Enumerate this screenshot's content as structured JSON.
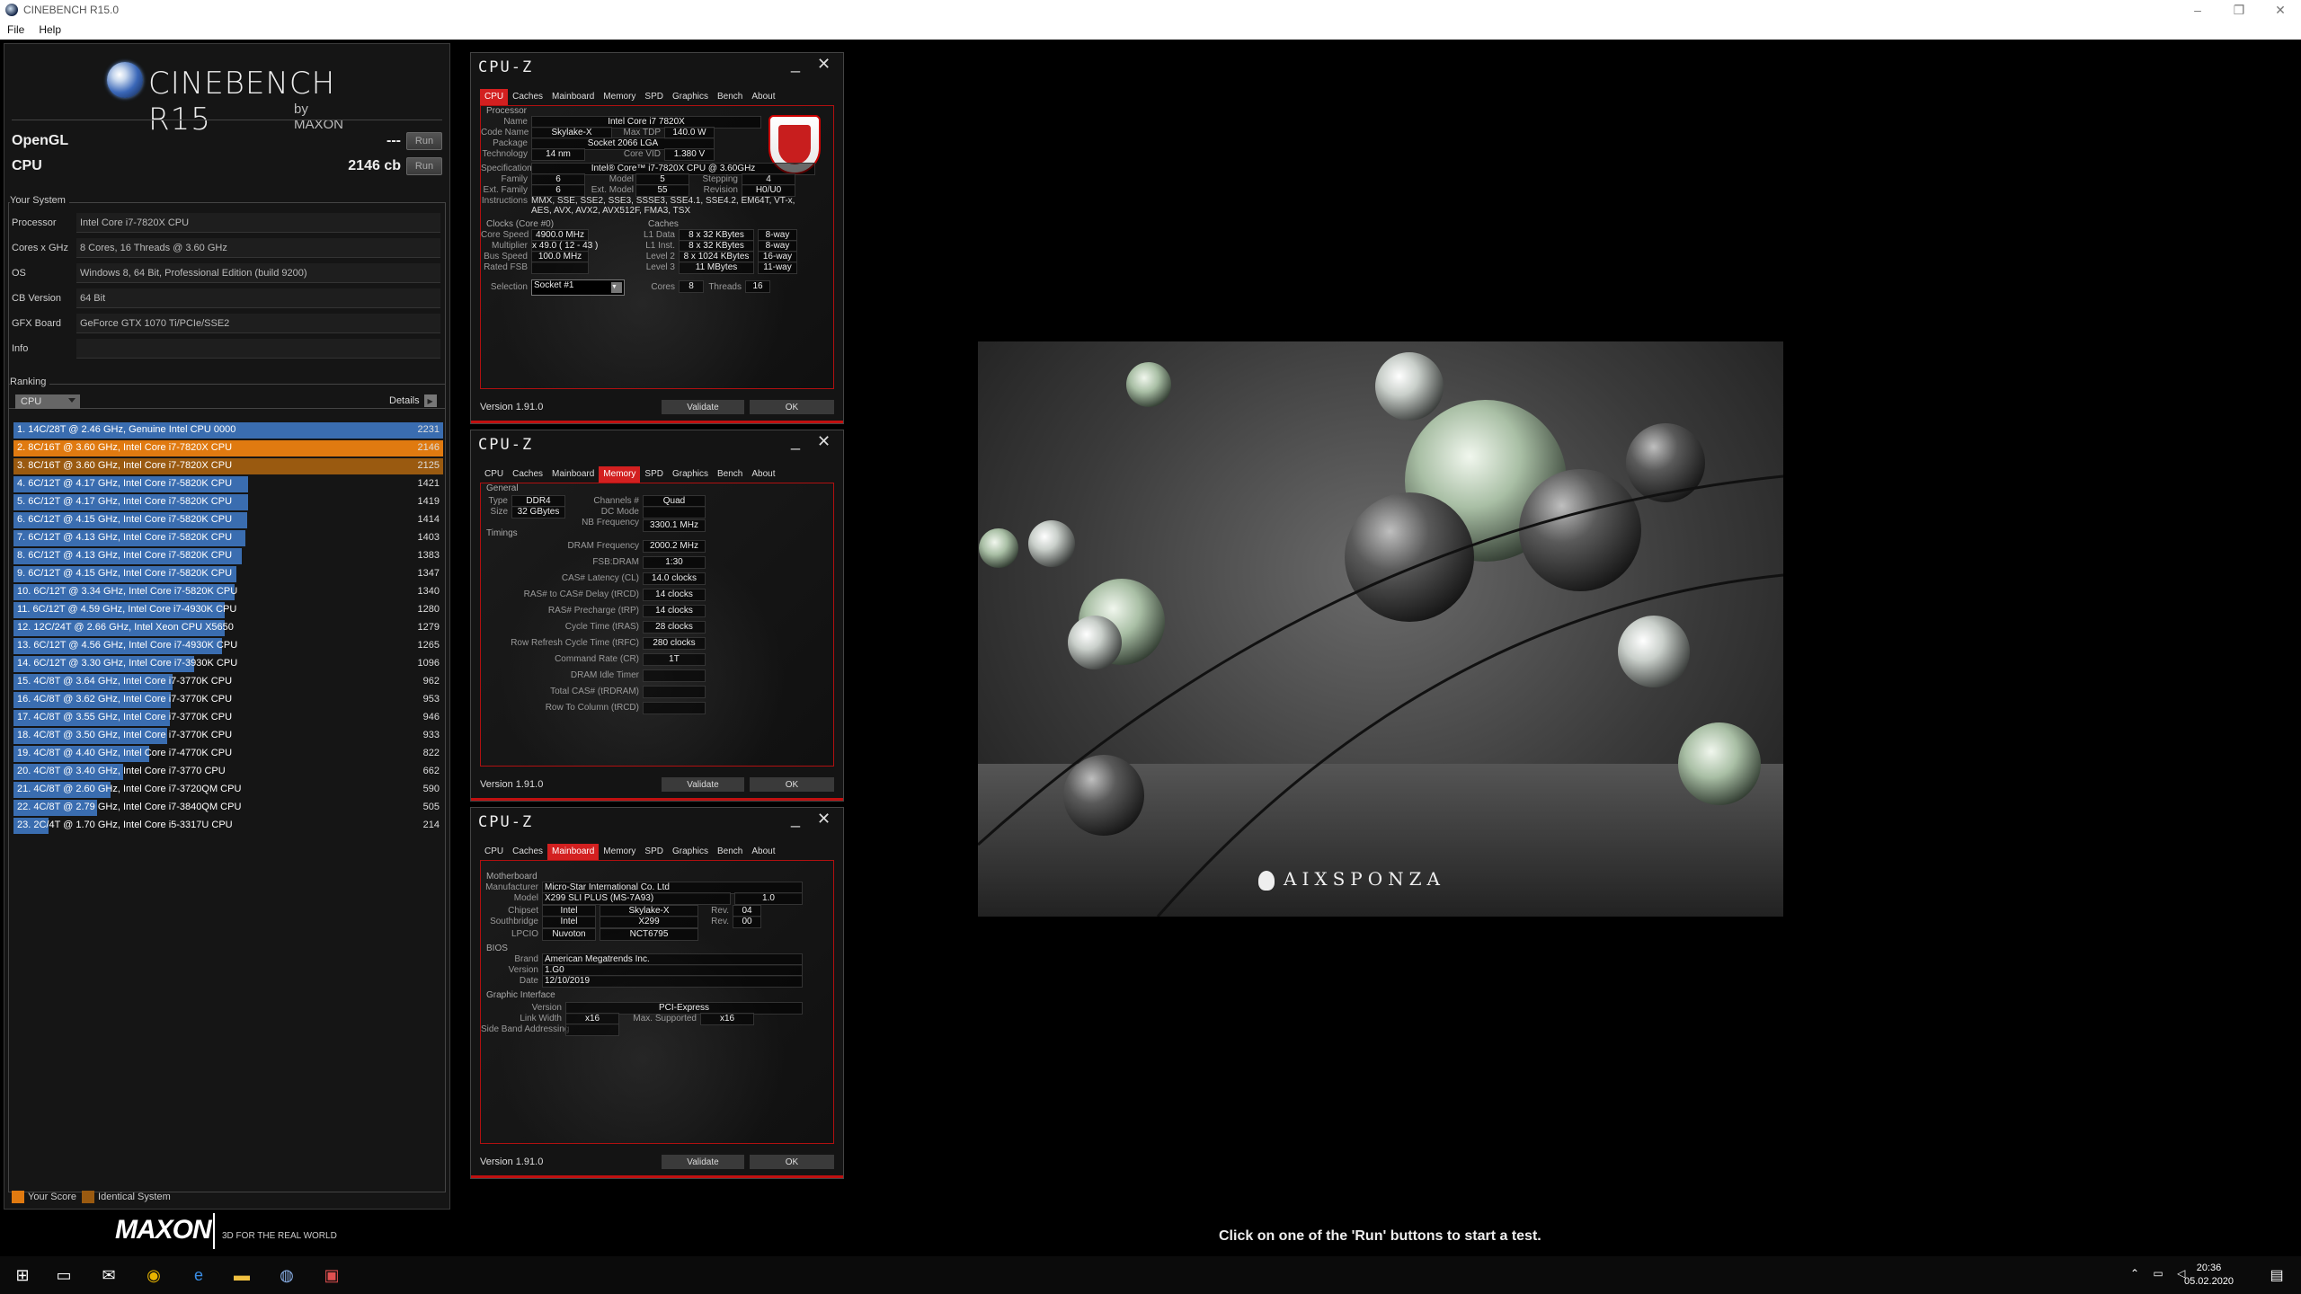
{
  "window": {
    "title": "CINEBENCH R15.0"
  },
  "menu": {
    "file": "File",
    "help": "Help"
  },
  "cinebench": {
    "logo": {
      "name": "CINEBENCH R15",
      "by": "by MAXON"
    },
    "opengl": {
      "label": "OpenGL",
      "value": "---",
      "run": "Run"
    },
    "cpu": {
      "label": "CPU",
      "value": "2146 cb",
      "run": "Run"
    },
    "your_system": {
      "title": "Your System",
      "rows": [
        {
          "k": "Processor",
          "v": "Intel Core i7-7820X CPU"
        },
        {
          "k": "Cores x GHz",
          "v": "8 Cores, 16 Threads @ 3.60 GHz"
        },
        {
          "k": "OS",
          "v": "Windows 8, 64 Bit, Professional Edition (build 9200)"
        },
        {
          "k": "CB Version",
          "v": "64 Bit"
        },
        {
          "k": "GFX Board",
          "v": "GeForce GTX 1070 Ti/PCIe/SSE2"
        },
        {
          "k": "Info",
          "v": ""
        }
      ]
    },
    "ranking": {
      "title": "Ranking",
      "select": "CPU",
      "details": "Details",
      "max": 2231,
      "items": [
        {
          "label": "1. 14C/28T @ 2.46 GHz, Genuine Intel CPU 0000",
          "score": 2231,
          "kind": "other"
        },
        {
          "label": "2. 8C/16T @ 3.60 GHz, Intel Core i7-7820X CPU",
          "score": 2146,
          "kind": "yours"
        },
        {
          "label": "3. 8C/16T @ 3.60 GHz, Intel Core i7-7820X CPU",
          "score": 2125,
          "kind": "identical"
        },
        {
          "label": "4. 6C/12T @ 4.17 GHz, Intel Core i7-5820K CPU",
          "score": 1421,
          "kind": "other"
        },
        {
          "label": "5. 6C/12T @ 4.17 GHz, Intel Core i7-5820K CPU",
          "score": 1419,
          "kind": "other"
        },
        {
          "label": "6. 6C/12T @ 4.15 GHz, Intel Core i7-5820K CPU",
          "score": 1414,
          "kind": "other"
        },
        {
          "label": "7. 6C/12T @ 4.13 GHz, Intel Core i7-5820K CPU",
          "score": 1403,
          "kind": "other"
        },
        {
          "label": "8. 6C/12T @ 4.13 GHz, Intel Core i7-5820K CPU",
          "score": 1383,
          "kind": "other"
        },
        {
          "label": "9. 6C/12T @ 4.15 GHz, Intel Core i7-5820K CPU",
          "score": 1347,
          "kind": "other"
        },
        {
          "label": "10. 6C/12T @ 3.34 GHz, Intel Core i7-5820K CPU",
          "score": 1340,
          "kind": "other"
        },
        {
          "label": "11. 6C/12T @ 4.59 GHz,  Intel Core i7-4930K CPU",
          "score": 1280,
          "kind": "other"
        },
        {
          "label": "12. 12C/24T @ 2.66 GHz, Intel Xeon CPU X5650",
          "score": 1279,
          "kind": "other"
        },
        {
          "label": "13. 6C/12T @ 4.56 GHz,  Intel Core i7-4930K CPU",
          "score": 1265,
          "kind": "other"
        },
        {
          "label": "14. 6C/12T @ 3.30 GHz,  Intel Core i7-3930K CPU",
          "score": 1096,
          "kind": "other"
        },
        {
          "label": "15. 4C/8T @ 3.64 GHz,  Intel Core i7-3770K CPU",
          "score": 962,
          "kind": "other"
        },
        {
          "label": "16. 4C/8T @ 3.62 GHz,  Intel Core i7-3770K CPU",
          "score": 953,
          "kind": "other"
        },
        {
          "label": "17. 4C/8T @ 3.55 GHz,  Intel Core i7-3770K CPU",
          "score": 946,
          "kind": "other"
        },
        {
          "label": "18. 4C/8T @ 3.50 GHz,  Intel Core i7-3770K CPU",
          "score": 933,
          "kind": "other"
        },
        {
          "label": "19. 4C/8T @ 4.40 GHz, Intel Core i7-4770K CPU",
          "score": 822,
          "kind": "other"
        },
        {
          "label": "20. 4C/8T @ 3.40 GHz,  Intel Core i7-3770 CPU",
          "score": 662,
          "kind": "other"
        },
        {
          "label": "21. 4C/8T @ 2.60 GHz,  Intel Core i7-3720QM CPU",
          "score": 590,
          "kind": "other"
        },
        {
          "label": "22. 4C/8T @ 2.79 GHz,  Intel Core i7-3840QM CPU",
          "score": 505,
          "kind": "other"
        },
        {
          "label": "23. 2C/4T @ 1.70 GHz,  Intel Core i5-3317U CPU",
          "score": 214,
          "kind": "other"
        }
      ]
    },
    "legend": {
      "yours": "Your Score",
      "identical": "Identical System"
    },
    "colors": {
      "yours": "#e07a10",
      "identical": "#9a5a10",
      "other": "#3a6db0"
    },
    "maxon": {
      "logo": "MAXON",
      "slogan": "3D FOR THE REAL WORLD"
    }
  },
  "cpuz": {
    "title": "CPU-Z",
    "tabs": [
      "CPU",
      "Caches",
      "Mainboard",
      "Memory",
      "SPD",
      "Graphics",
      "Bench",
      "About"
    ],
    "version": "Version 1.91.0",
    "validate": "Validate",
    "ok": "OK",
    "cpu": {
      "processor_group": "Processor",
      "name_l": "Name",
      "name": "Intel Core i7 7820X",
      "codename_l": "Code Name",
      "codename": "Skylake-X",
      "maxtdp_l": "Max TDP",
      "maxtdp": "140.0 W",
      "package_l": "Package",
      "package": "Socket 2066 LGA",
      "technology_l": "Technology",
      "technology": "14 nm",
      "corevid_l": "Core VID",
      "corevid": "1.380 V",
      "spec_l": "Specification",
      "spec": "Intel® Core™ i7-7820X CPU @ 3.60GHz",
      "family_l": "Family",
      "family": "6",
      "model_l": "Model",
      "model": "5",
      "stepping_l": "Stepping",
      "stepping": "4",
      "extfamily_l": "Ext. Family",
      "extfamily": "6",
      "extmodel_l": "Ext. Model",
      "extmodel": "55",
      "revision_l": "Revision",
      "revision": "H0/U0",
      "instr_l": "Instructions",
      "instr1": "MMX, SSE, SSE2, SSE3, SSSE3, SSE4.1, SSE4.2, EM64T, VT-x,",
      "instr2": "AES, AVX, AVX2, AVX512F, FMA3, TSX",
      "clocks_group": "Clocks (Core #0)",
      "corespeed_l": "Core Speed",
      "corespeed": "4900.0 MHz",
      "multiplier_l": "Multiplier",
      "multiplier": "x 49.0 ( 12 - 43 )",
      "busspeed_l": "Bus Speed",
      "busspeed": "100.0 MHz",
      "ratedfsb_l": "Rated FSB",
      "ratedfsb": "",
      "caches_group": "Caches",
      "l1d_l": "L1 Data",
      "l1d": "8 x 32 KBytes",
      "l1d_w": "8-way",
      "l1i_l": "L1 Inst.",
      "l1i": "8 x 32 KBytes",
      "l1i_w": "8-way",
      "l2_l": "Level 2",
      "l2": "8 x 1024 KBytes",
      "l2_w": "16-way",
      "l3_l": "Level 3",
      "l3": "11 MBytes",
      "l3_w": "11-way",
      "selection_l": "Selection",
      "selection": "Socket #1",
      "cores_l": "Cores",
      "cores": "8",
      "threads_l": "Threads",
      "threads": "16"
    },
    "memory": {
      "general_group": "General",
      "type_l": "Type",
      "type": "DDR4",
      "channels_l": "Channels #",
      "channels": "Quad",
      "size_l": "Size",
      "size": "32 GBytes",
      "dcmode_l": "DC Mode",
      "dcmode": "",
      "nbfreq_l": "NB Frequency",
      "nbfreq": "3300.1 MHz",
      "timings_group": "Timings",
      "rows": [
        {
          "k": "DRAM Frequency",
          "v": "2000.2 MHz"
        },
        {
          "k": "FSB:DRAM",
          "v": "1:30"
        },
        {
          "k": "CAS# Latency (CL)",
          "v": "14.0 clocks"
        },
        {
          "k": "RAS# to CAS# Delay (tRCD)",
          "v": "14 clocks"
        },
        {
          "k": "RAS# Precharge (tRP)",
          "v": "14 clocks"
        },
        {
          "k": "Cycle Time (tRAS)",
          "v": "28 clocks"
        },
        {
          "k": "Row Refresh Cycle Time (tRFC)",
          "v": "280 clocks"
        },
        {
          "k": "Command Rate (CR)",
          "v": "1T"
        },
        {
          "k": "DRAM Idle Timer",
          "v": ""
        },
        {
          "k": "Total CAS# (tRDRAM)",
          "v": ""
        },
        {
          "k": "Row To Column (tRCD)",
          "v": ""
        }
      ]
    },
    "mainboard": {
      "mb_group": "Motherboard",
      "manufacturer_l": "Manufacturer",
      "manufacturer": "Micro-Star International Co. Ltd",
      "model_l": "Model",
      "model": "X299 SLI PLUS (MS-7A93)",
      "model_rev": "1.0",
      "chipset_l": "Chipset",
      "chipset_v": "Intel",
      "chipset_n": "Skylake-X",
      "chipset_rev_l": "Rev.",
      "chipset_rev": "04",
      "south_l": "Southbridge",
      "south_v": "Intel",
      "south_n": "X299",
      "south_rev_l": "Rev.",
      "south_rev": "00",
      "lpcio_l": "LPCIO",
      "lpcio_v": "Nuvoton",
      "lpcio_n": "NCT6795",
      "bios_group": "BIOS",
      "brand_l": "Brand",
      "brand": "American Megatrends Inc.",
      "version_l": "Version",
      "version": "1.G0",
      "date_l": "Date",
      "date": "12/10/2019",
      "gi_group": "Graphic Interface",
      "giver_l": "Version",
      "giver": "PCI-Express",
      "linkwidth_l": "Link Width",
      "linkwidth": "x16",
      "maxsup_l": "Max. Supported",
      "maxsup": "x16",
      "sba_l": "Side Band Addressing",
      "sba": ""
    }
  },
  "render": {
    "watermark": "AIXSPONZA"
  },
  "status": "Click on one of the 'Run' buttons to start a test.",
  "taskbar": {
    "time": "20:36",
    "date": "05.02.2020"
  }
}
